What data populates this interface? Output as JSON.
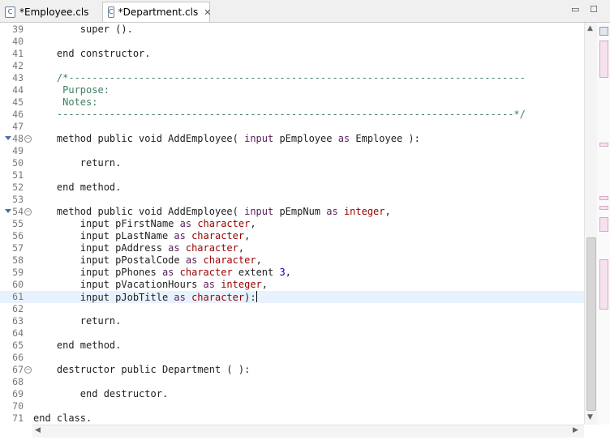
{
  "tabs": [
    {
      "label": "*Employee.cls",
      "icon": "C",
      "active": false
    },
    {
      "label": "*Department.cls",
      "icon": "C",
      "active": true
    }
  ],
  "lines": [
    {
      "n": "39",
      "parts": [
        [
          "t",
          "        super ()."
        ]
      ]
    },
    {
      "n": "40",
      "parts": []
    },
    {
      "n": "41",
      "parts": [
        [
          "t",
          "    end constructor."
        ]
      ]
    },
    {
      "n": "42",
      "parts": []
    },
    {
      "n": "43",
      "parts": [
        [
          "cm",
          "    /*------------------------------------------------------------------------------"
        ]
      ]
    },
    {
      "n": "44",
      "parts": [
        [
          "cm",
          "     Purpose:"
        ]
      ]
    },
    {
      "n": "45",
      "parts": [
        [
          "cm",
          "     Notes:"
        ]
      ]
    },
    {
      "n": "46",
      "parts": [
        [
          "cm",
          "    ------------------------------------------------------------------------------*/"
        ]
      ]
    },
    {
      "n": "47",
      "parts": []
    },
    {
      "n": "48",
      "fold": true,
      "parts": [
        [
          "t",
          "    method public void AddEmployee( "
        ],
        [
          "kw",
          "input"
        ],
        [
          "t",
          " pEmployee "
        ],
        [
          "kw",
          "as"
        ],
        [
          "t",
          " Employee ):"
        ]
      ]
    },
    {
      "n": "49",
      "parts": []
    },
    {
      "n": "50",
      "parts": [
        [
          "t",
          "        return."
        ]
      ]
    },
    {
      "n": "51",
      "parts": []
    },
    {
      "n": "52",
      "parts": [
        [
          "t",
          "    end method."
        ]
      ]
    },
    {
      "n": "53",
      "parts": []
    },
    {
      "n": "54",
      "fold": true,
      "parts": [
        [
          "t",
          "    method public void AddEmployee( "
        ],
        [
          "kw",
          "input"
        ],
        [
          "t",
          " pEmpNum "
        ],
        [
          "kw",
          "as"
        ],
        [
          "t",
          " "
        ],
        [
          "kw2",
          "integer"
        ],
        [
          "t",
          ","
        ]
      ]
    },
    {
      "n": "55",
      "parts": [
        [
          "t",
          "        input pFirstName "
        ],
        [
          "kw",
          "as"
        ],
        [
          "t",
          " "
        ],
        [
          "kw2",
          "character"
        ],
        [
          "t",
          ","
        ]
      ]
    },
    {
      "n": "56",
      "parts": [
        [
          "t",
          "        input pLastName "
        ],
        [
          "kw",
          "as"
        ],
        [
          "t",
          " "
        ],
        [
          "kw2",
          "character"
        ],
        [
          "t",
          ","
        ]
      ]
    },
    {
      "n": "57",
      "parts": [
        [
          "t",
          "        input pAddress "
        ],
        [
          "kw",
          "as"
        ],
        [
          "t",
          " "
        ],
        [
          "kw2",
          "character"
        ],
        [
          "t",
          ","
        ]
      ]
    },
    {
      "n": "58",
      "parts": [
        [
          "t",
          "        input pPostalCode "
        ],
        [
          "kw",
          "as"
        ],
        [
          "t",
          " "
        ],
        [
          "kw2",
          "character"
        ],
        [
          "t",
          ","
        ]
      ]
    },
    {
      "n": "59",
      "parts": [
        [
          "t",
          "        input pPhones "
        ],
        [
          "kw",
          "as"
        ],
        [
          "t",
          " "
        ],
        [
          "kw2",
          "character"
        ],
        [
          "t",
          " extent "
        ],
        [
          "num",
          "3"
        ],
        [
          "t",
          ","
        ]
      ]
    },
    {
      "n": "60",
      "parts": [
        [
          "t",
          "        input pVacationHours "
        ],
        [
          "kw",
          "as"
        ],
        [
          "t",
          " "
        ],
        [
          "kw2",
          "integer"
        ],
        [
          "t",
          ","
        ]
      ]
    },
    {
      "n": "61",
      "current": true,
      "caret": true,
      "parts": [
        [
          "t",
          "        input pJobTitle "
        ],
        [
          "kw",
          "as"
        ],
        [
          "t",
          " "
        ],
        [
          "kw2",
          "character"
        ],
        [
          "t",
          "):"
        ]
      ]
    },
    {
      "n": "62",
      "parts": []
    },
    {
      "n": "63",
      "parts": [
        [
          "t",
          "        return."
        ]
      ]
    },
    {
      "n": "64",
      "parts": []
    },
    {
      "n": "65",
      "parts": [
        [
          "t",
          "    end method."
        ]
      ]
    },
    {
      "n": "66",
      "parts": []
    },
    {
      "n": "67",
      "foldbox": true,
      "parts": [
        [
          "t",
          "    destructor public Department ( ):"
        ]
      ]
    },
    {
      "n": "68",
      "parts": []
    },
    {
      "n": "69",
      "parts": [
        [
          "t",
          "        end destructor."
        ]
      ]
    },
    {
      "n": "70",
      "parts": []
    },
    {
      "n": "71",
      "parts": [
        [
          "t",
          "end class."
        ]
      ]
    }
  ],
  "icons": {
    "minimize": "minimize-icon",
    "maximize": "maximize-icon",
    "close": "close-icon"
  }
}
